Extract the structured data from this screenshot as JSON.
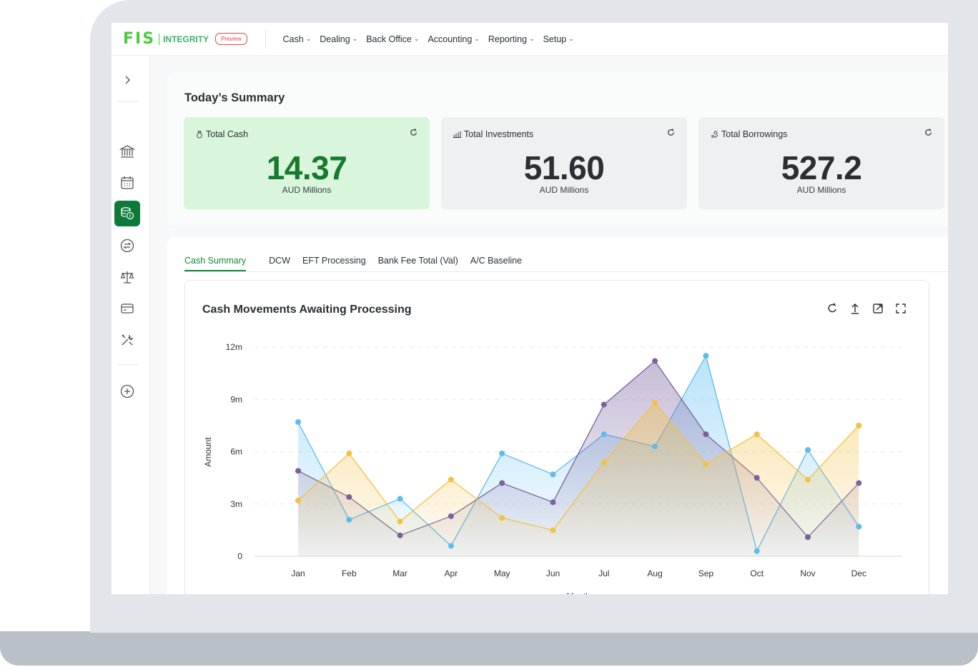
{
  "app": {
    "logo_text": "FIS",
    "product": "INTEGRITY",
    "badge": "Preview"
  },
  "menu": [
    {
      "label": "Cash"
    },
    {
      "label": "Dealing"
    },
    {
      "label": "Back Office"
    },
    {
      "label": "Accounting"
    },
    {
      "label": "Reporting"
    },
    {
      "label": "Setup"
    }
  ],
  "sidebar": {
    "items": [
      {
        "icon": "chevron-right-icon"
      },
      {
        "icon": "bank-icon"
      },
      {
        "icon": "calendar-icon"
      },
      {
        "icon": "coins-icon",
        "active": true
      },
      {
        "icon": "transfer-icon"
      },
      {
        "icon": "scales-icon"
      },
      {
        "icon": "card-icon"
      },
      {
        "icon": "tools-icon"
      },
      {
        "icon": "add-icon"
      }
    ]
  },
  "summary": {
    "title": "Today’s Summary",
    "cards": [
      {
        "label": "Total Cash",
        "value": "14.37",
        "unit": "AUD Millions"
      },
      {
        "label": "Total Investments",
        "value": "51.60",
        "unit": "AUD Millions"
      },
      {
        "label": "Total Borrowings",
        "value": "527.2",
        "unit": "AUD Millions"
      }
    ]
  },
  "tabs": [
    {
      "label": "Cash Summary",
      "active": true
    },
    {
      "label": "DCW"
    },
    {
      "label": "EFT Processing"
    },
    {
      "label": "Bank Fee Total (Val)"
    },
    {
      "label": "A/C Baseline"
    }
  ],
  "colors": {
    "brand_green": "#4bcd3e",
    "active_green": "#0d7a3a",
    "series_blue": "#5bbcf0",
    "series_purple": "#7a619e",
    "series_orange": "#f5c043"
  },
  "chart_data": {
    "type": "area",
    "title": "Cash Movements Awaiting Processing",
    "xlabel": "Month",
    "ylabel": "Amount",
    "categories": [
      "Jan",
      "Feb",
      "Mar",
      "Apr",
      "May",
      "Jun",
      "Jul",
      "Aug",
      "Sep",
      "Oct",
      "Nov",
      "Dec"
    ],
    "yticks": [
      "0",
      "3m",
      "6m",
      "9m",
      "12m"
    ],
    "ylim": [
      0,
      12
    ],
    "grid": true,
    "series": [
      {
        "color": "#5bbcf0",
        "values": [
          7.7,
          2.1,
          3.3,
          0.6,
          5.9,
          4.7,
          7.0,
          6.3,
          11.5,
          0.3,
          6.1,
          1.7
        ]
      },
      {
        "color": "#7a619e",
        "values": [
          4.9,
          3.4,
          1.2,
          2.3,
          4.2,
          3.1,
          8.7,
          11.2,
          7.0,
          4.5,
          1.1,
          4.2
        ]
      },
      {
        "color": "#f5c043",
        "values": [
          3.2,
          5.9,
          2.0,
          4.4,
          2.2,
          1.5,
          5.4,
          8.8,
          5.3,
          7.0,
          4.4,
          7.5
        ]
      }
    ]
  }
}
